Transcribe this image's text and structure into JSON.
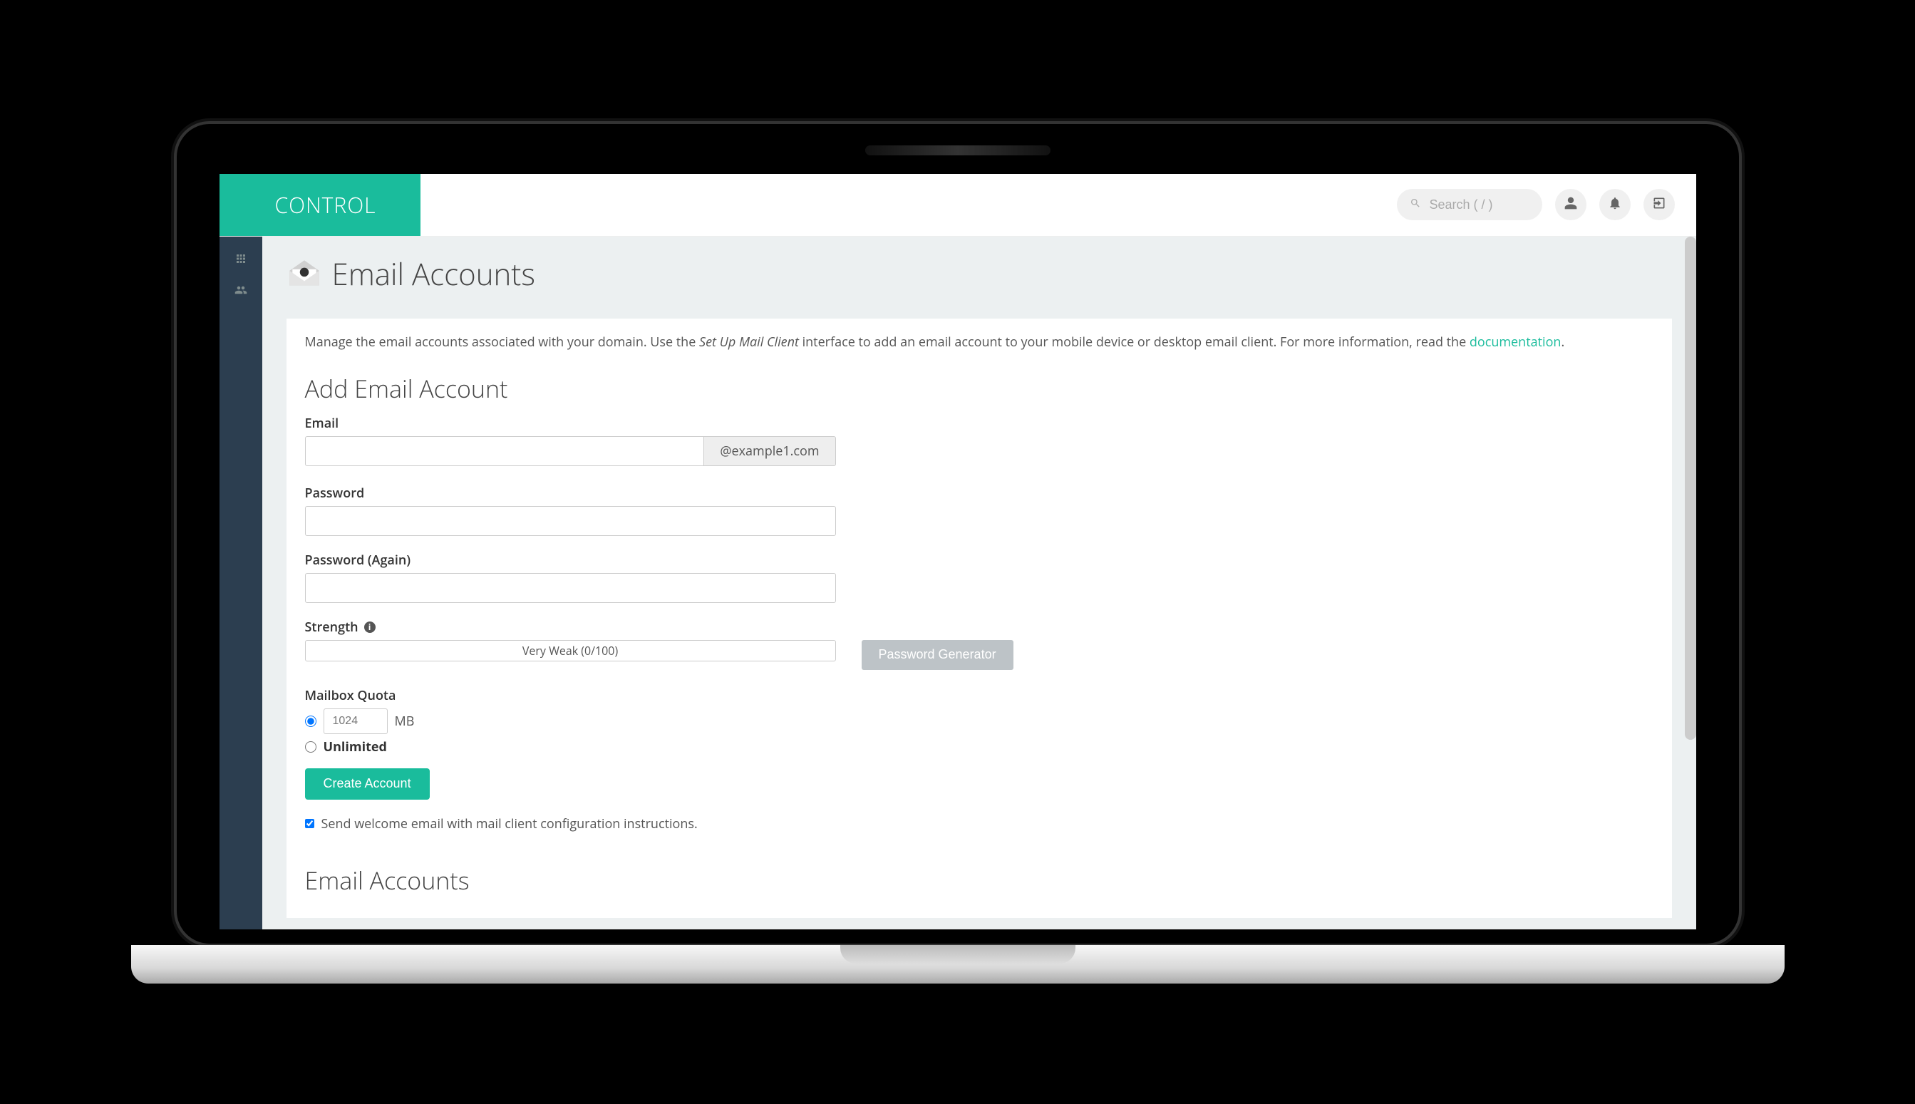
{
  "brand": "CONTROL",
  "search": {
    "placeholder": "Search ( / )"
  },
  "page": {
    "title": "Email Accounts",
    "intro_before": "Manage the email accounts associated with your domain. Use the ",
    "intro_em": "Set Up Mail Client",
    "intro_after": " interface to add an email account to your mobile device or desktop email client. For more information, read the ",
    "intro_link": "documentation",
    "intro_period": "."
  },
  "form": {
    "section_title": "Add Email Account",
    "email_label": "Email",
    "email_addon": "@example1.com",
    "password_label": "Password",
    "password_again_label": "Password (Again)",
    "strength_label": "Strength",
    "strength_text": "Very Weak (0/100)",
    "pwgen_label": "Password Generator",
    "quota_label": "Mailbox Quota",
    "quota_value": "1024",
    "quota_unit": "MB",
    "unlimited_label": "Unlimited",
    "create_label": "Create Account",
    "welcome_label": "Send welcome email with mail client configuration instructions."
  },
  "accounts": {
    "section_title": "Email Accounts"
  }
}
